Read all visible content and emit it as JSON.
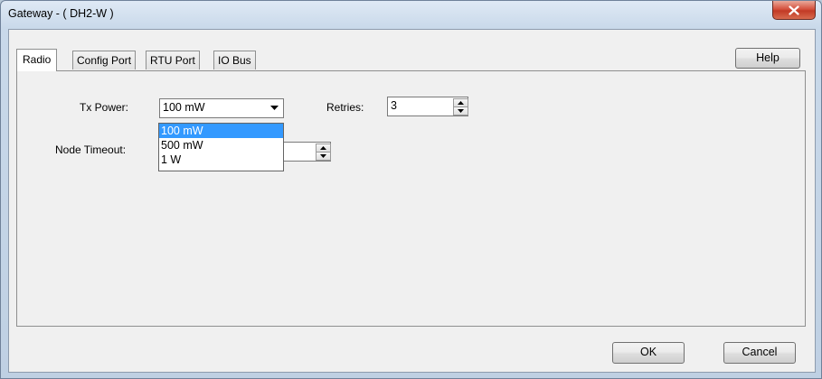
{
  "window": {
    "title": "Gateway - ( DH2-W )"
  },
  "tabs": [
    {
      "label": "Radio",
      "active": true
    },
    {
      "label": "Config Port",
      "active": false
    },
    {
      "label": "RTU Port",
      "active": false
    },
    {
      "label": "IO Bus",
      "active": false
    }
  ],
  "buttons": {
    "help": "Help",
    "ok": "OK",
    "cancel": "Cancel"
  },
  "radio": {
    "tx_power_label": "Tx Power:",
    "tx_power_value": "100 mW",
    "tx_power_options": [
      "100 mW",
      "500 mW",
      "1 W"
    ],
    "tx_power_highlighted": "100 mW",
    "retries_label": "Retries:",
    "retries_value": "3",
    "node_timeout_label": "Node Timeout:"
  },
  "icons": {
    "close": "close-x-icon",
    "combo_arrow": "chevron-down-icon",
    "spin_up": "arrow-up-icon",
    "spin_down": "arrow-down-icon"
  },
  "colors": {
    "close_button": "#c8452f",
    "dropdown_highlight": "#3399ff",
    "window_frame": "#c9d9ea",
    "dialog_bg": "#f0f0f0"
  }
}
